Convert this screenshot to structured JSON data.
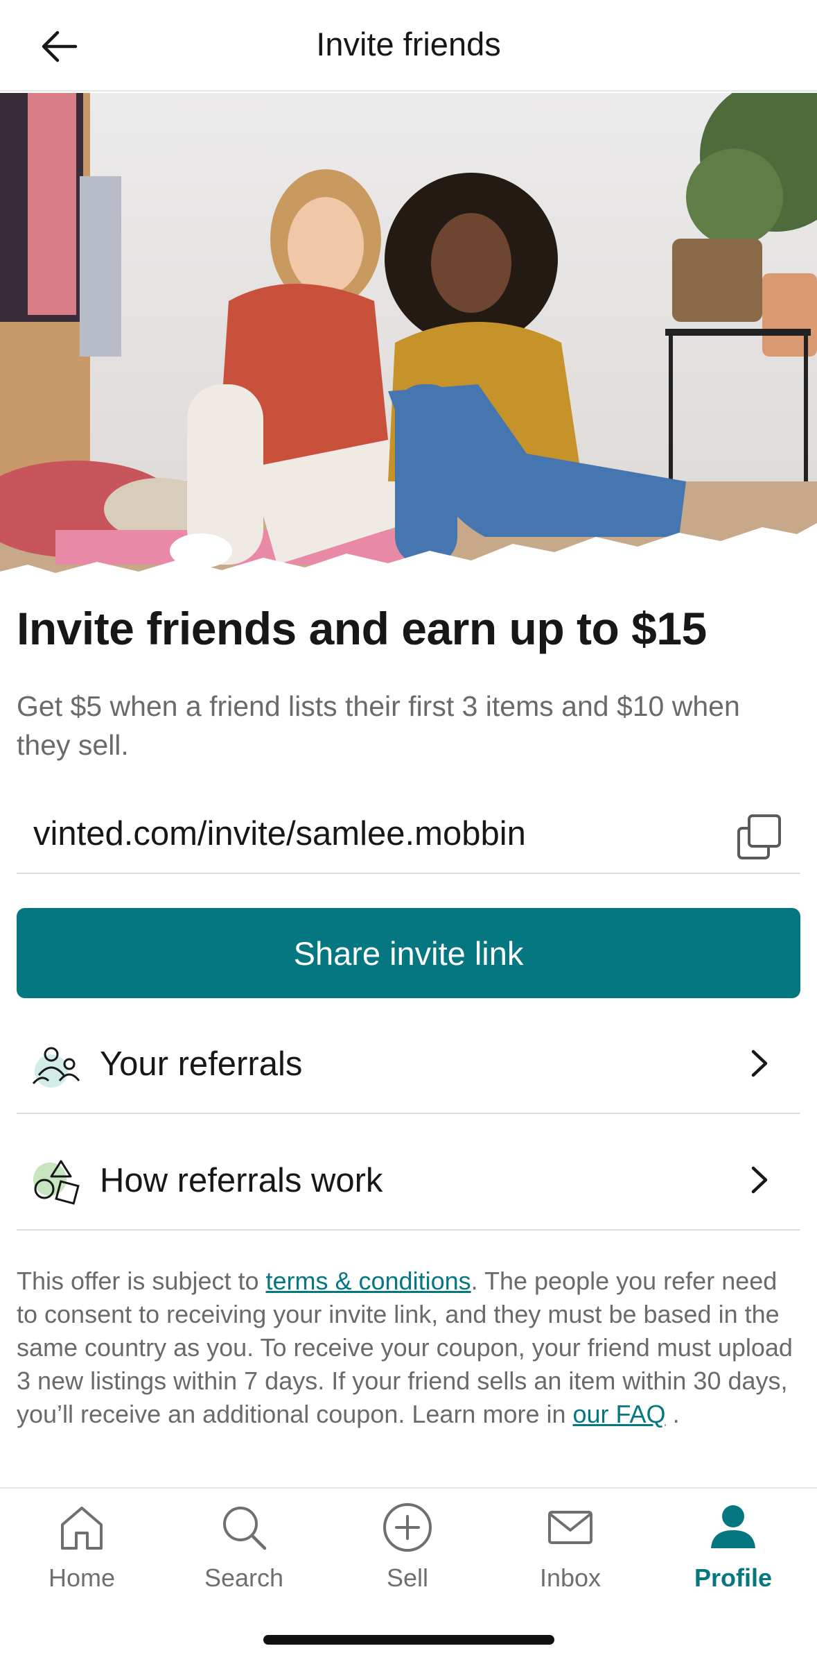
{
  "header": {
    "title": "Invite friends",
    "back_icon": "arrow-left-icon"
  },
  "hero": {
    "image": "two-women-sitting-on-floor-photo"
  },
  "promo": {
    "headline": "Invite friends and earn up to $15",
    "subtext": "Get $5 when a friend lists their first 3 items and $10 when they sell."
  },
  "invite": {
    "url": "vinted.com/invite/samlee.mobbin",
    "copy_icon": "copy-icon",
    "share_label": "Share invite link"
  },
  "menu": {
    "items": [
      {
        "label": "Your referrals",
        "icon": "people-icon"
      },
      {
        "label": "How referrals work",
        "icon": "shapes-icon"
      }
    ]
  },
  "legal": {
    "prefix": "This offer is subject to ",
    "terms_link": "terms & conditions",
    "middle": ". The people you refer need to consent to receiving your invite link, and they must be based in the same country as you. To receive your coupon, your friend must upload 3 new listings within 7 days. If your friend sells an item within 30 days, you’ll receive an additional coupon. Learn more in ",
    "faq_link": "our FAQ",
    "suffix": " ."
  },
  "tabs": [
    {
      "label": "Home",
      "icon": "home-icon",
      "active": false
    },
    {
      "label": "Search",
      "icon": "search-icon",
      "active": false
    },
    {
      "label": "Sell",
      "icon": "plus-circle-icon",
      "active": false
    },
    {
      "label": "Inbox",
      "icon": "mail-icon",
      "active": false
    },
    {
      "label": "Profile",
      "icon": "profile-icon",
      "active": true
    }
  ],
  "colors": {
    "accent": "#047780",
    "text": "#171717",
    "muted": "#6a6a6a",
    "divider": "#dcdcdc"
  }
}
